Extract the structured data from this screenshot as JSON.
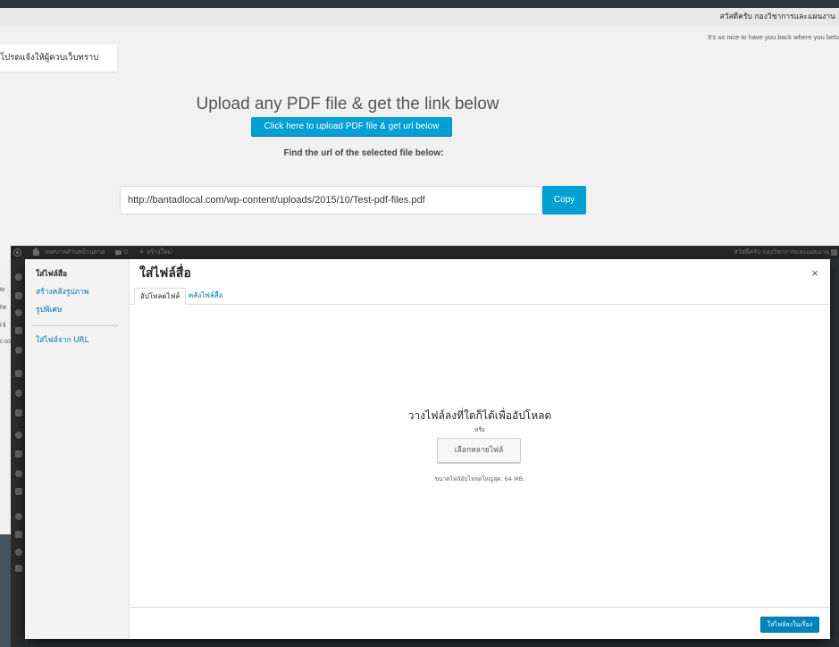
{
  "outer_admin": {
    "greeting": "สวัสดีครับ กองวิชาการและแผนงาน",
    "tagline": "It's so nice to have you back where you belo"
  },
  "notice": {
    "text": "โปรดแจ้งให้ผู้ควบเว็บทราบ"
  },
  "uploader": {
    "heading": "Upload any PDF file & get the link below",
    "upload_button": "Click here to upload PDF file & get url below",
    "find_label": "Find the url of the selected file below:",
    "url_value": "http://bantadlocal.com/wp-content/uploads/2015/10/Test-pdf-files.pdf",
    "copy_button": "Copy"
  },
  "background_fragments": [
    "to",
    "he",
    "t fi",
    "c co"
  ],
  "nested_admin_bar": {
    "site_name": "เทศบาลตำบลบ้านตาด",
    "comment_count": "0",
    "new_plus": "+",
    "new_label": "สร้างใหม่",
    "greeting": "สวัสดีครับ กองวิชาการและแผนงาน"
  },
  "media_modal": {
    "sidebar": {
      "items": [
        {
          "label": "ใส่ไฟล์สื่อ",
          "active": true
        },
        {
          "label": "สร้างคลังรูปภาพ",
          "active": false
        },
        {
          "label": "รูปพิเศษ",
          "active": false
        },
        {
          "label": "ใส่ไฟล์จาก URL",
          "active": false
        }
      ]
    },
    "title": "ใส่ไฟล์สื่อ",
    "close": "×",
    "tabs": [
      {
        "label": "อัปโหลดไฟล์",
        "active": true
      },
      {
        "label": "คลังไฟล์สื่อ",
        "active": false
      }
    ],
    "uploader": {
      "drop_text": "วางไฟล์ลงที่ใดก็ได้เพื่ออัปโหลด",
      "or": "หรือ",
      "select_button": "เลือกหลายไฟล์",
      "max_size": "ขนาดไฟล์อัปโหลดใหญ่สุด: 64 MB."
    },
    "insert_button": "ใส่ไฟล์ลงในเรื่อง"
  },
  "icons": {
    "wordpress_logo": "wordpress-logo-icon",
    "home": "home-icon",
    "comments": "comment-bubble-icon",
    "avatar": "avatar-icon",
    "close": "close-icon",
    "admin_menu": [
      "dashboard-icon",
      "posts-icon",
      "media-icon",
      "links-icon",
      "pages-icon",
      "comments-icon",
      "appearance-icon",
      "plugins-icon",
      "users-icon",
      "tools-icon",
      "settings-icon",
      "forms-icon",
      "security-icon",
      "seo-icon",
      "analytics-icon",
      "collapse-icon"
    ]
  },
  "colors": {
    "admin_bar": "#32373c",
    "primary_button": "#00a0d2",
    "link": "#0073aa",
    "insert_button": "#0085ba",
    "overlay": "#2e3033"
  }
}
